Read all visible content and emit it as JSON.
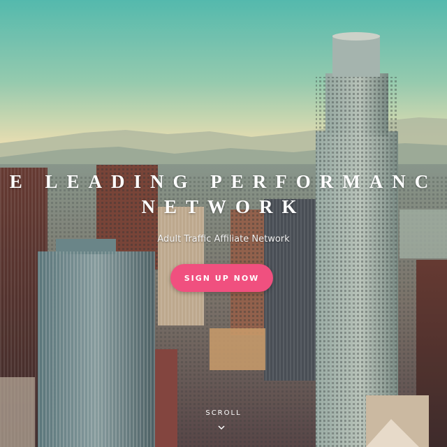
{
  "hero": {
    "headline_line1": "E LEADING PERFORMANC",
    "headline_line2": "NETWORK",
    "subtitle": "Adult Traffic Affiliate Network",
    "cta_label": "SIGN UP NOW",
    "scroll_label": "SCROLL",
    "scroll_icon": "chevron-down-icon"
  },
  "colors": {
    "accent": "#f0507f",
    "text": "#ffffff",
    "sky_top": "#3fb6b0",
    "sky_horizon": "#f0e7b8"
  }
}
